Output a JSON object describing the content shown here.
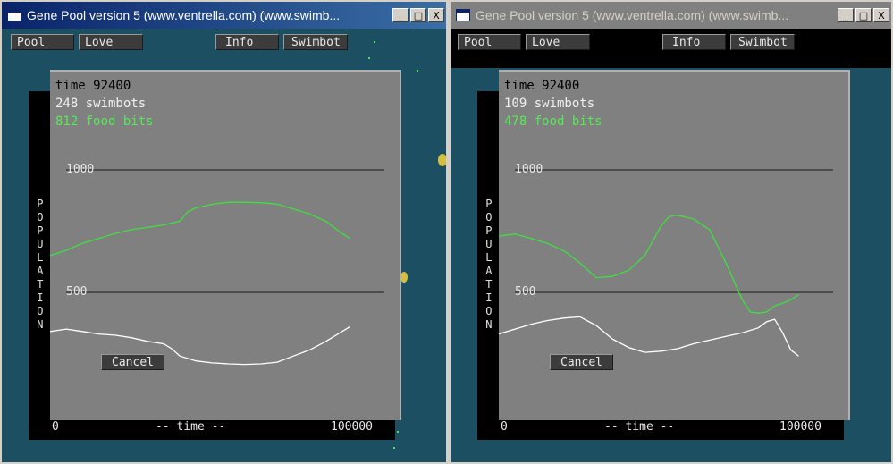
{
  "windows": [
    {
      "title": "Gene Pool version 5 (www.ventrella.com) (www.swimb...",
      "toolbar": [
        "Pool",
        "Love",
        "Info",
        "Swimbot"
      ],
      "stats": {
        "time": "time  92400",
        "swimbots": "248  swimbots",
        "food": "812  food bits"
      },
      "side_label": "POPULATION",
      "axis": {
        "y_high": "1000",
        "y_low": "500",
        "x_start": "0",
        "x_mid": "-- time --",
        "x_end": "100000"
      },
      "cancel_label": "Cancel",
      "window_buttons": {
        "minimize": "_",
        "maximize": "□",
        "close": "X"
      }
    },
    {
      "title": "Gene Pool version 5 (www.ventrella.com) (www.swimb...",
      "toolbar": [
        "Pool",
        "Love",
        "Info",
        "Swimbot"
      ],
      "stats": {
        "time": "time  92400",
        "swimbots": "109  swimbots",
        "food": "478  food bits"
      },
      "side_label": "POPULATION",
      "axis": {
        "y_high": "1000",
        "y_low": "500",
        "x_start": "0",
        "x_mid": "-- time --",
        "x_end": "100000"
      },
      "cancel_label": "Cancel",
      "window_buttons": {
        "minimize": "_",
        "maximize": "□",
        "close": "X"
      }
    }
  ],
  "chart_data": [
    {
      "type": "line",
      "xlim": [
        0,
        100000
      ],
      "ylim": [
        0,
        1200
      ],
      "series": [
        {
          "name": "food bits",
          "color": "#3ee03e",
          "x": [
            0,
            5000,
            10000,
            15000,
            20000,
            25000,
            30000,
            35000,
            40000,
            42500,
            45000,
            50000,
            55000,
            60000,
            65000,
            70000,
            75000,
            80000,
            85000,
            90000,
            92400
          ],
          "values": [
            650,
            672,
            700,
            720,
            740,
            756,
            765,
            775,
            790,
            830,
            845,
            860,
            868,
            868,
            866,
            860,
            840,
            820,
            790,
            740,
            720
          ]
        },
        {
          "name": "swimbots",
          "color": "#ffffff",
          "x": [
            0,
            5000,
            10000,
            15000,
            20000,
            25000,
            30000,
            35000,
            37500,
            40000,
            45000,
            50000,
            55000,
            60000,
            65000,
            70000,
            75000,
            80000,
            85000,
            90000,
            92400
          ],
          "values": [
            340,
            350,
            340,
            330,
            325,
            315,
            300,
            290,
            270,
            240,
            220,
            212,
            208,
            206,
            208,
            215,
            240,
            265,
            300,
            340,
            360
          ]
        }
      ]
    },
    {
      "type": "line",
      "xlim": [
        0,
        100000
      ],
      "ylim": [
        0,
        1200
      ],
      "series": [
        {
          "name": "food bits",
          "color": "#3ee03e",
          "x": [
            0,
            5000,
            10000,
            15000,
            20000,
            25000,
            30000,
            35000,
            40000,
            45000,
            50000,
            52500,
            55000,
            60000,
            65000,
            70000,
            75000,
            77500,
            80000,
            82500,
            85000,
            87500,
            90000,
            92400
          ],
          "values": [
            730,
            738,
            720,
            700,
            670,
            620,
            560,
            565,
            590,
            650,
            770,
            810,
            815,
            800,
            755,
            620,
            470,
            420,
            415,
            420,
            445,
            455,
            470,
            490
          ]
        },
        {
          "name": "swimbots",
          "color": "#ffffff",
          "x": [
            0,
            5000,
            10000,
            15000,
            20000,
            25000,
            30000,
            35000,
            40000,
            45000,
            50000,
            55000,
            60000,
            65000,
            70000,
            75000,
            80000,
            82500,
            85000,
            87500,
            90000,
            92400
          ],
          "values": [
            330,
            350,
            370,
            385,
            395,
            400,
            365,
            310,
            275,
            255,
            260,
            270,
            290,
            305,
            320,
            335,
            355,
            380,
            390,
            335,
            265,
            240
          ]
        }
      ]
    }
  ]
}
